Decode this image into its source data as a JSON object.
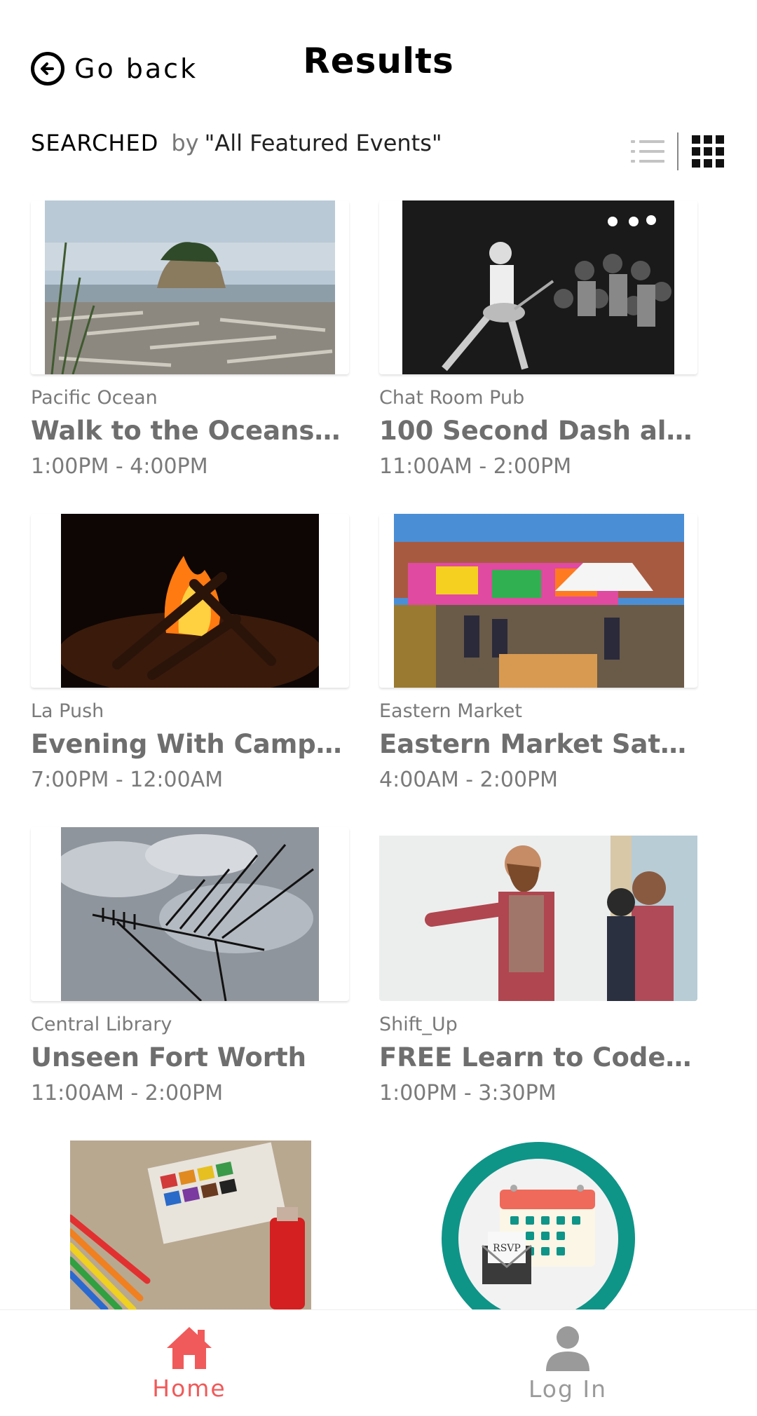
{
  "header": {
    "back_label": "Go back",
    "title": "Results"
  },
  "search": {
    "label": "SEARCHED",
    "by": "by",
    "query": "\"All Featured Events\""
  },
  "view_toggle": {
    "list_icon": "list-icon",
    "grid_icon": "grid-icon",
    "active": "grid"
  },
  "events": [
    {
      "venue": "Pacific Ocean",
      "title": "Walk to the Oceansi...",
      "time": "1:00PM - 4:00PM",
      "image": "coastal-sea-stack-photo"
    },
    {
      "venue": "Chat Room Pub",
      "title": "100 Second Dash alb...",
      "time": "11:00AM - 2:00PM",
      "image": "punk-concert-photo"
    },
    {
      "venue": "La Push",
      "title": "Evening With Campfi...",
      "time": "7:00PM - 12:00AM",
      "image": "campfire-photo"
    },
    {
      "venue": "Eastern Market",
      "title": "Eastern Market Satur...",
      "time": "4:00AM - 2:00PM",
      "image": "farmers-market-photo"
    },
    {
      "venue": "Central Library",
      "title": "Unseen Fort Worth",
      "time": "11:00AM - 2:00PM",
      "image": "antenna-sky-photo"
    },
    {
      "venue": "Shift_Up",
      "title": "FREE Learn to Code ...",
      "time": "1:00PM - 3:30PM",
      "image": "whiteboard-coding-photo"
    },
    {
      "venue": "",
      "title": "",
      "time": "",
      "image": "art-supplies-photo"
    },
    {
      "venue": "",
      "title": "",
      "time": "",
      "image": "rsvp-calendar-icon",
      "rsvp_text": "RSVP"
    }
  ],
  "bottom_nav": {
    "home_label": "Home",
    "login_label": "Log In"
  },
  "colors": {
    "accent": "#f05a5a",
    "teal": "#0f9488",
    "muted": "#7a7a7a"
  }
}
